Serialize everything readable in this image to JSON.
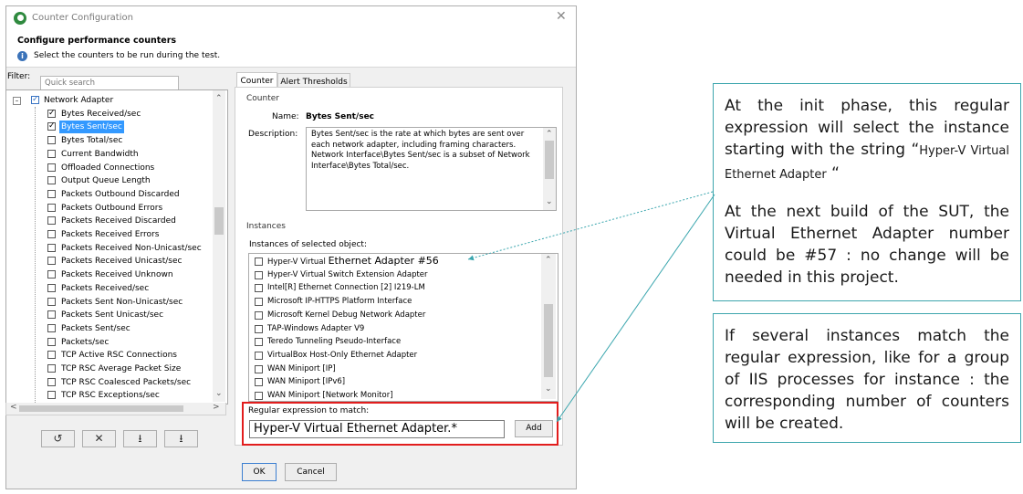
{
  "dialog": {
    "title": "Counter Configuration",
    "header_title": "Configure performance counters",
    "header_subtitle": "Select the counters to be run during the test.",
    "filter_label": "Filter:",
    "search_placeholder": "Quick search",
    "tree": {
      "parent_label": "Network Adapter",
      "items": [
        {
          "label": "Bytes Received/sec",
          "checked": true
        },
        {
          "label": "Bytes Sent/sec",
          "checked": true,
          "selected": true
        },
        {
          "label": "Bytes Total/sec",
          "checked": false
        },
        {
          "label": "Current Bandwidth",
          "checked": false
        },
        {
          "label": "Offloaded Connections",
          "checked": false
        },
        {
          "label": "Output Queue Length",
          "checked": false
        },
        {
          "label": "Packets Outbound Discarded",
          "checked": false
        },
        {
          "label": "Packets Outbound Errors",
          "checked": false
        },
        {
          "label": "Packets Received Discarded",
          "checked": false
        },
        {
          "label": "Packets Received Errors",
          "checked": false
        },
        {
          "label": "Packets Received Non-Unicast/sec",
          "checked": false
        },
        {
          "label": "Packets Received Unicast/sec",
          "checked": false
        },
        {
          "label": "Packets Received Unknown",
          "checked": false
        },
        {
          "label": "Packets Received/sec",
          "checked": false
        },
        {
          "label": "Packets Sent Non-Unicast/sec",
          "checked": false
        },
        {
          "label": "Packets Sent Unicast/sec",
          "checked": false
        },
        {
          "label": "Packets Sent/sec",
          "checked": false
        },
        {
          "label": "Packets/sec",
          "checked": false
        },
        {
          "label": "TCP Active RSC Connections",
          "checked": false
        },
        {
          "label": "TCP RSC Average Packet Size",
          "checked": false
        },
        {
          "label": "TCP RSC Coalesced Packets/sec",
          "checked": false
        },
        {
          "label": "TCP RSC Exceptions/sec",
          "checked": false
        }
      ]
    },
    "toolbar_icons": [
      "undo-icon",
      "delete-icon",
      "import-icon",
      "export-icon"
    ],
    "tabs": [
      "Counter",
      "Alert Thresholds"
    ],
    "counter_group_label": "Counter",
    "name_label": "Name:",
    "name_value": "Bytes Sent/sec",
    "description_label": "Description:",
    "description_value": "Bytes Sent/sec is the rate at which bytes are sent over each network adapter, including framing characters. Network Interface\\Bytes Sent/sec is a subset of Network Interface\\Bytes Total/sec.",
    "instances_group_label": "Instances",
    "instances_of_selected_label": "Instances of selected object:",
    "instances": [
      {
        "label_prefix": "Hyper-V Virtual ",
        "label_suffix": "Ethernet Adapter #56"
      },
      {
        "label": "Hyper-V Virtual Switch Extension Adapter"
      },
      {
        "label": "Intel[R] Ethernet Connection [2] I219-LM"
      },
      {
        "label": "Microsoft IP-HTTPS Platform Interface"
      },
      {
        "label": "Microsoft Kernel Debug Network Adapter"
      },
      {
        "label": "TAP-Windows Adapter V9"
      },
      {
        "label": "Teredo Tunneling Pseudo-Interface"
      },
      {
        "label": "VirtualBox Host-Only Ethernet Adapter"
      },
      {
        "label": "WAN Miniport [IP]"
      },
      {
        "label": "WAN Miniport [IPv6]"
      },
      {
        "label": "WAN Miniport [Network Monitor]"
      }
    ],
    "regex_label": "Regular expression to match:",
    "regex_value": "Hyper-V Virtual Ethernet Adapter.*",
    "add_button": "Add",
    "ok_button": "OK",
    "cancel_button": "Cancel"
  },
  "callouts": {
    "top_part1": "At the init phase, this regular expression will select the instance starting with the string “",
    "top_part2": "Hyper-V Virtual Ethernet Adapter",
    "top_part3": " “",
    "top_paragraph2": "At the next build of the SUT, the Virtual Ethernet Adapter number could be #57 : no change will be needed in this project.",
    "bottom": "If several instances match the regular expression, like for a group of IIS processes for instance : the corresponding number of counters will be created."
  },
  "colors": {
    "highlight_red": "#e21d1d",
    "callout_border": "#3da6ad",
    "selection_blue": "#3399ff",
    "arrow_teal": "#3aa6ae"
  }
}
